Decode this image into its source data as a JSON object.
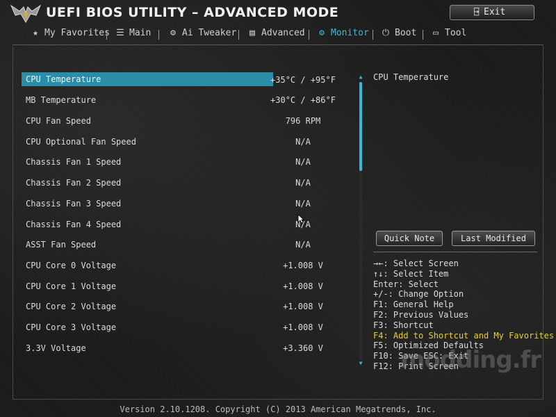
{
  "header": {
    "title": "UEFI BIOS UTILITY – ADVANCED MODE",
    "exit_label": "Exit"
  },
  "tabs": [
    {
      "label": "My Favorites",
      "icon": "star-icon"
    },
    {
      "label": "Main",
      "icon": "list-icon"
    },
    {
      "label": "Ai Tweaker",
      "icon": "tweaker-icon"
    },
    {
      "label": "Advanced",
      "icon": "advanced-icon"
    },
    {
      "label": "Monitor",
      "icon": "monitor-icon",
      "active": true
    },
    {
      "label": "Boot",
      "icon": "power-icon"
    },
    {
      "label": "Tool",
      "icon": "tool-icon"
    }
  ],
  "monitor": {
    "items": [
      {
        "label": "CPU Temperature",
        "value": "+35°C / +95°F"
      },
      {
        "label": "MB Temperature",
        "value": "+30°C / +86°F"
      },
      {
        "label": "CPU Fan Speed",
        "value": "796 RPM"
      },
      {
        "label": "CPU Optional Fan Speed",
        "value": "N/A"
      },
      {
        "label": "Chassis Fan 1 Speed",
        "value": "N/A"
      },
      {
        "label": "Chassis Fan 2 Speed",
        "value": "N/A"
      },
      {
        "label": "Chassis Fan 3 Speed",
        "value": "N/A"
      },
      {
        "label": "Chassis Fan 4 Speed",
        "value": "N/A"
      },
      {
        "label": "ASST Fan Speed",
        "value": "N/A"
      },
      {
        "label": "CPU Core 0 Voltage",
        "value": "+1.008 V"
      },
      {
        "label": "CPU Core 1 Voltage",
        "value": "+1.008 V"
      },
      {
        "label": "CPU Core 2 Voltage",
        "value": "+1.008 V"
      },
      {
        "label": "CPU Core 3 Voltage",
        "value": "+1.008 V"
      },
      {
        "label": "3.3V Voltage",
        "value": "+3.360 V"
      }
    ]
  },
  "help": {
    "title": "CPU Temperature",
    "quick_note": "Quick Note",
    "last_modified": "Last Modified",
    "keys": [
      "→←: Select Screen",
      "↑↓: Select Item",
      "Enter: Select",
      "+/-: Change Option",
      "F1: General Help",
      "F2: Previous Values",
      "F3: Shortcut",
      "F4: Add to Shortcut and My Favorites",
      "F5: Optimized Defaults",
      "F10: Save  ESC: Exit",
      "F12: Print Screen"
    ]
  },
  "footer": {
    "text": "Version 2.10.1208. Copyright (C) 2013 American Megatrends, Inc."
  },
  "watermark": "modding.fr",
  "colors": {
    "accent": "#38b8d8",
    "selection": "#2b8ea8",
    "highlight_key": "#e6d12e"
  }
}
